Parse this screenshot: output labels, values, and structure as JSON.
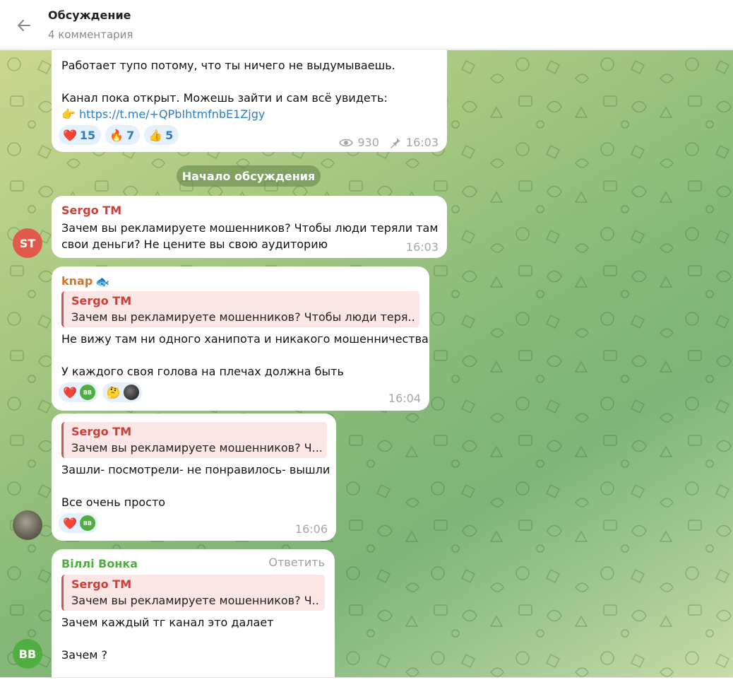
{
  "header": {
    "title": "Обсуждение",
    "subtitle": "4 комментария"
  },
  "post": {
    "line1": "Работает тупо потому, что ты ничего не выдумываешь.",
    "line2": "Канал пока открыт. Можешь зайти и сам всё увидеть:",
    "pointer_emoji": "👉",
    "link": "https://t.me/+QPbIhtmfnbE1Zjgy",
    "reactions": [
      {
        "emoji": "❤️",
        "count": "15"
      },
      {
        "emoji": "🔥",
        "count": "7"
      },
      {
        "emoji": "👍",
        "count": "5"
      }
    ],
    "views": "930",
    "time": "16:03"
  },
  "divider": "Начало обсуждения",
  "messages": [
    {
      "sender": "Sergo TM",
      "avatar_initials": "ST",
      "line1": "Зачем вы рекламируете мошенников? Чтобы люди теряли там",
      "line2": "свои деньги? Не цените вы свою аудиторию",
      "time": "16:03"
    },
    {
      "sender": "knap",
      "sender_badge": "🐟",
      "reply_name": "Sergo TM",
      "reply_text": "Зачем вы рекламируете мошенников? Чтобы люди теря...",
      "line1": "Не вижу там ни одного ханипота и никакого мошенничества",
      "line2": "У каждого своя голова на плечах должна быть",
      "reaction1": "❤️",
      "reaction1_user": "BB",
      "reaction2": "🤔",
      "time": "16:04"
    },
    {
      "reply_name": "Sergo TM",
      "reply_text": "Зачем вы рекламируете мошенников? Ч...",
      "line1": "Зашли- посмотрели- не понравилось- вышли",
      "line2": "Все очень просто",
      "reaction1": "❤️",
      "reaction1_user": "BB",
      "time": "16:06"
    },
    {
      "sender": "Віллі Вонка",
      "avatar_initials": "BB",
      "reply_action": "Ответить",
      "reply_name": "Sergo TM",
      "reply_text": "Зачем вы рекламируете мошенников? Ч...",
      "line1": "Зачем каждый тг канал это далает",
      "line2": "Зачем ?"
    }
  ],
  "colors": {
    "sergo_avatar": "#e05a4b",
    "sergo_name": "#c9403b",
    "knap_name": "#d0782a",
    "willi_name": "#4fae3f",
    "bb_avatar": "#4fae3f",
    "link": "#2c7dc7",
    "reaction_text": "#2c7dc7"
  }
}
